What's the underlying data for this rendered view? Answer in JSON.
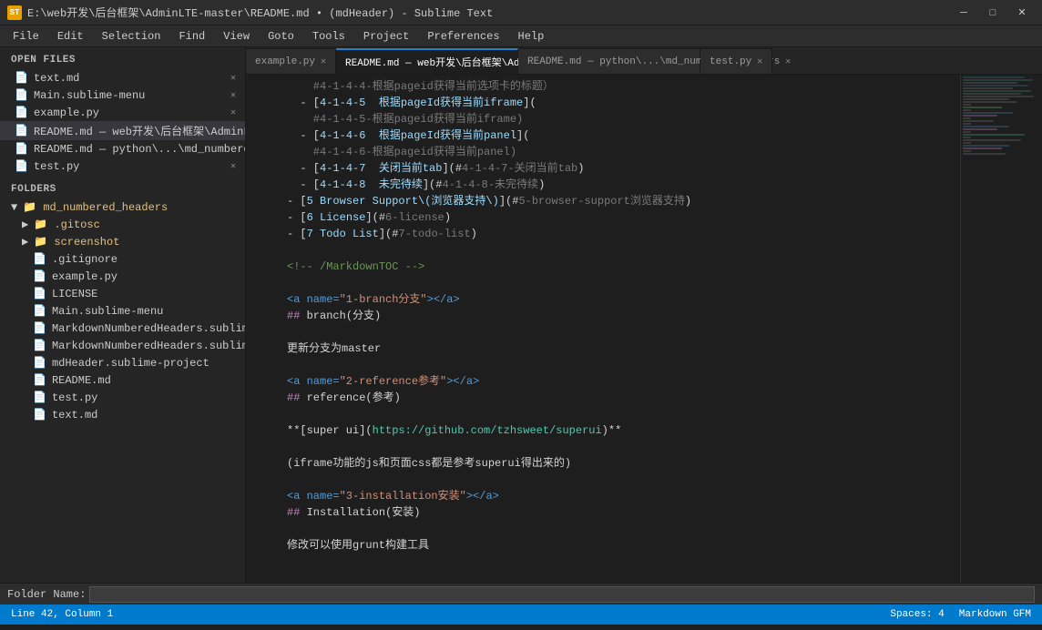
{
  "titlebar": {
    "title": "E:\\web开发\\后台框架\\AdminLTE-master\\README.md • (mdHeader) - Sublime Text",
    "app_icon": "ST",
    "min_label": "─",
    "max_label": "□",
    "close_label": "✕"
  },
  "menu": {
    "items": [
      "File",
      "Edit",
      "Selection",
      "Find",
      "View",
      "Goto",
      "Tools",
      "Project",
      "Preferences",
      "Help"
    ]
  },
  "tabs": [
    {
      "label": "example.py",
      "active": false,
      "modified": false
    },
    {
      "label": "README.md — web开发\\后台框架\\AdminLTE-master",
      "active": true,
      "modified": true
    },
    {
      "label": "README.md — python\\...\\md_numbered_headers",
      "active": false,
      "modified": false
    },
    {
      "label": "test.py",
      "active": false,
      "modified": false
    }
  ],
  "sidebar": {
    "open_files_title": "OPEN FILES",
    "open_files": [
      {
        "name": "text.md",
        "active": false
      },
      {
        "name": "Main.sublime-menu",
        "active": false
      },
      {
        "name": "example.py",
        "active": false
      },
      {
        "name": "README.md — web开发\\后台框架\\AdminLTE-...",
        "active": true
      },
      {
        "name": "README.md — python\\...\\md_numbered_hea",
        "active": false
      },
      {
        "name": "test.py",
        "active": false
      }
    ],
    "folders_title": "FOLDERS",
    "folders": [
      {
        "name": "md_numbered_headers",
        "type": "root-folder",
        "indent": 0
      },
      {
        "name": ".gitosc",
        "type": "folder",
        "indent": 1
      },
      {
        "name": "screenshot",
        "type": "folder",
        "indent": 1
      },
      {
        "name": ".gitignore",
        "type": "file",
        "indent": 1
      },
      {
        "name": "example.py",
        "type": "file",
        "indent": 1
      },
      {
        "name": "LICENSE",
        "type": "file",
        "indent": 1
      },
      {
        "name": "Main.sublime-menu",
        "type": "file",
        "indent": 1
      },
      {
        "name": "MarkdownNumberedHeaders.sublime-c",
        "type": "file",
        "indent": 1
      },
      {
        "name": "MarkdownNumberedHeaders.sublime-s",
        "type": "file",
        "indent": 1
      },
      {
        "name": "mdHeader.sublime-project",
        "type": "file",
        "indent": 1
      },
      {
        "name": "README.md",
        "type": "file",
        "indent": 1
      },
      {
        "name": "test.py",
        "type": "file",
        "indent": 1
      },
      {
        "name": "text.md",
        "type": "file",
        "indent": 1
      }
    ]
  },
  "editor": {
    "lines": [
      {
        "num": "",
        "content": "    #4-1-4-4-根据pageid获得当前选项卡的标题）",
        "type": "comment"
      },
      {
        "num": "",
        "content": "  - [4-1-4-5  根据pageId获得当前iframe](",
        "type": "mixed"
      },
      {
        "num": "",
        "content": "    #4-1-4-5-根据pageid获得当前iframe)",
        "type": "comment"
      },
      {
        "num": "",
        "content": "  - [4-1-4-6  根据pageId获得当前panel](",
        "type": "mixed"
      },
      {
        "num": "",
        "content": "    #4-1-4-6-根据pageid获得当前panel)",
        "type": "comment"
      },
      {
        "num": "",
        "content": "  - [4-1-4-7  关闭当前tab](#4-1-4-7-关闭当前tab)",
        "type": "mixed"
      },
      {
        "num": "",
        "content": "  - [4-1-4-8  未完待续](#4-1-4-8-未完待续)",
        "type": "mixed"
      },
      {
        "num": "",
        "content": "- [5 Browser Support\\(浏览器支持\\)](#5-browser-support浏览器支持)",
        "type": "mixed"
      },
      {
        "num": "",
        "content": "- [6 License](#6-license)",
        "type": "mixed"
      },
      {
        "num": "",
        "content": "- [7 Todo List](#7-todo-list)",
        "type": "mixed"
      },
      {
        "num": "",
        "content": "",
        "type": "empty"
      },
      {
        "num": "",
        "content": "<!-- /MarkdownTOC -->",
        "type": "comment"
      },
      {
        "num": "",
        "content": "",
        "type": "empty"
      },
      {
        "num": "",
        "content": "<a name=\"1-branch分支\"></a>",
        "type": "tag"
      },
      {
        "num": "",
        "content": "## branch(分支)",
        "type": "heading"
      },
      {
        "num": "",
        "content": "",
        "type": "empty"
      },
      {
        "num": "",
        "content": "更新分支为master",
        "type": "text"
      },
      {
        "num": "",
        "content": "",
        "type": "empty"
      },
      {
        "num": "",
        "content": "<a name=\"2-reference参考\"></a>",
        "type": "tag"
      },
      {
        "num": "",
        "content": "## reference(参考)",
        "type": "heading"
      },
      {
        "num": "",
        "content": "",
        "type": "empty"
      },
      {
        "num": "",
        "content": "**[super ui](https://github.com/tzhsweet/superui)**",
        "type": "link"
      },
      {
        "num": "",
        "content": "",
        "type": "empty"
      },
      {
        "num": "",
        "content": "(iframe功能的js和页面css都是参考superui得出来的)",
        "type": "text"
      },
      {
        "num": "",
        "content": "",
        "type": "empty"
      },
      {
        "num": "",
        "content": "<a name=\"3-installation安装\"></a>",
        "type": "tag"
      },
      {
        "num": "",
        "content": "## Installation(安装)",
        "type": "heading"
      },
      {
        "num": "",
        "content": "",
        "type": "empty"
      },
      {
        "num": "",
        "content": "修改可以使用grunt构建工具",
        "type": "text"
      }
    ]
  },
  "folder_name_bar": {
    "label": "Folder Name:",
    "value": ""
  },
  "status_bar": {
    "left": "Line 42, Column 1",
    "right_spaces": "Spaces: 4",
    "right_lang": "Markdown GFM"
  }
}
